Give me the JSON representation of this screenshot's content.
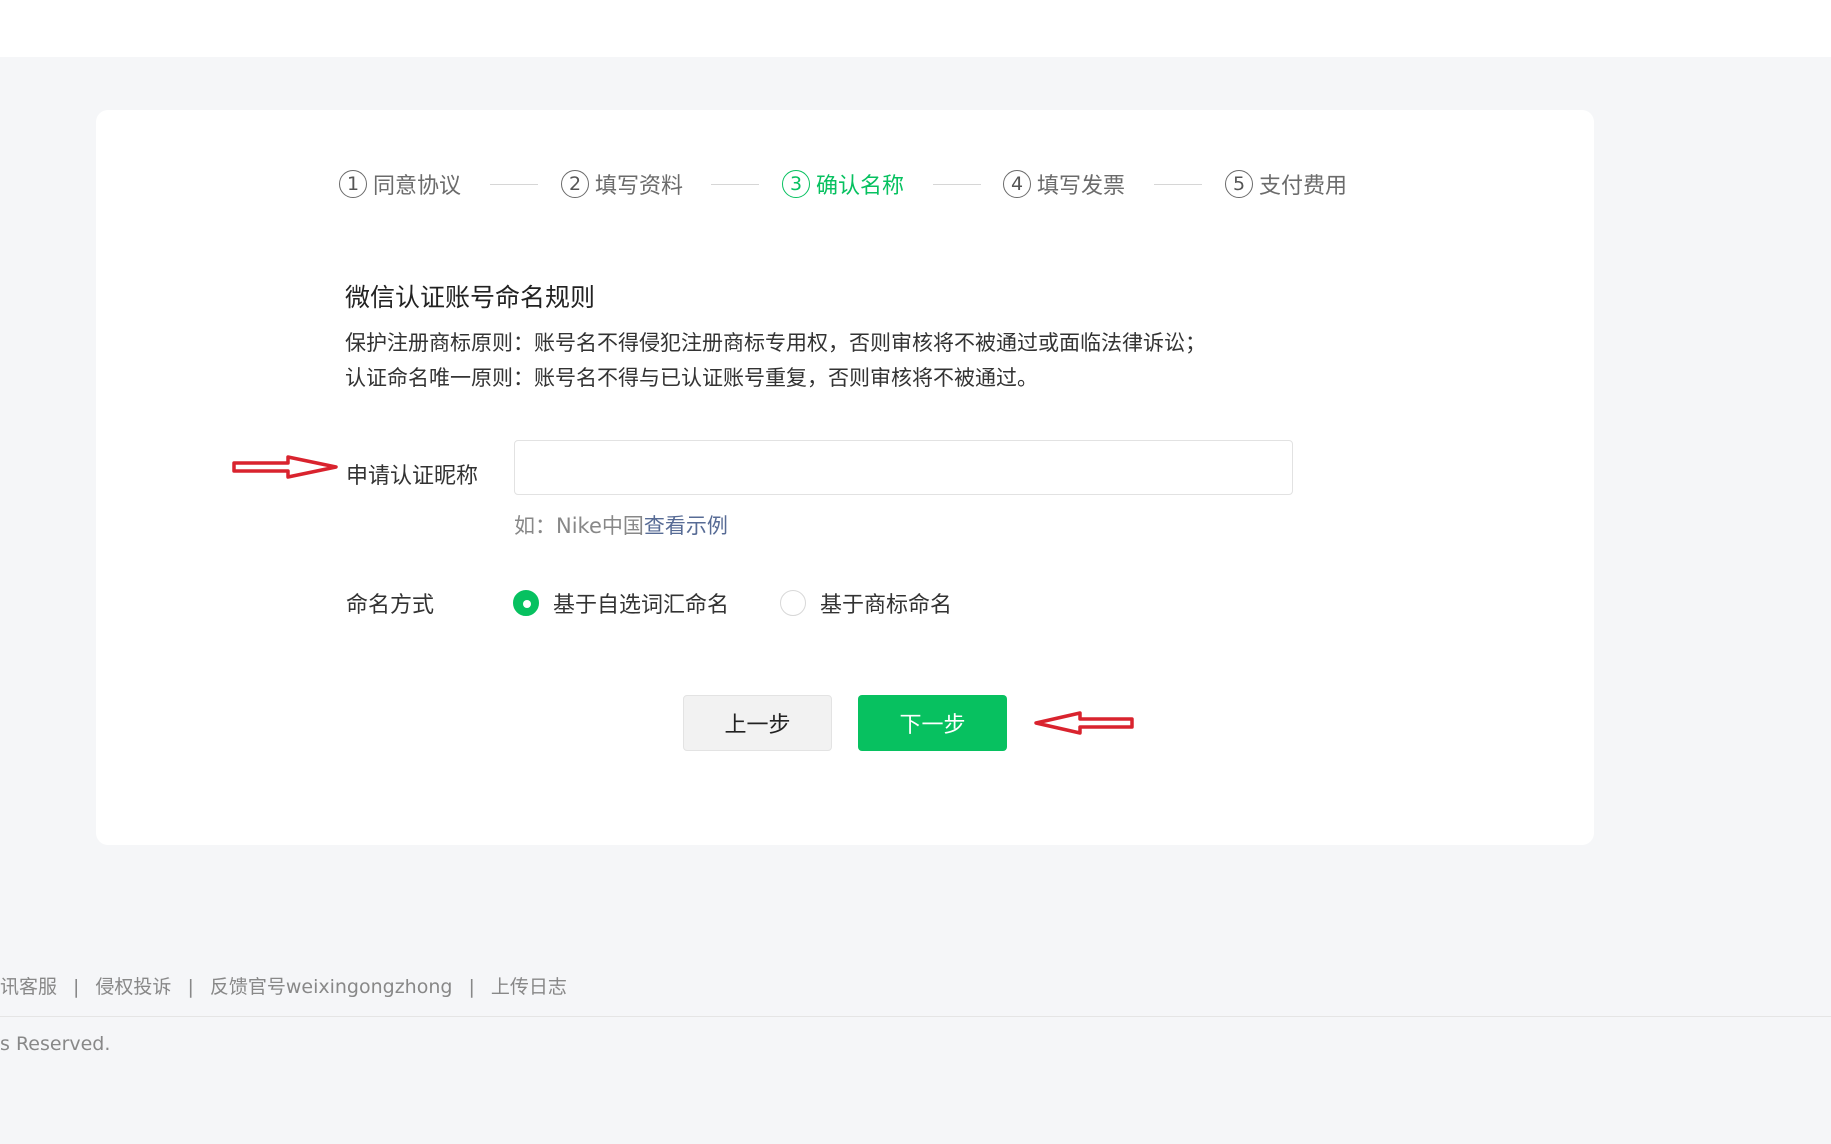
{
  "steps": [
    {
      "num": "1",
      "label": "同意协议"
    },
    {
      "num": "2",
      "label": "填写资料"
    },
    {
      "num": "3",
      "label": "确认名称",
      "active": true
    },
    {
      "num": "4",
      "label": "填写发票"
    },
    {
      "num": "5",
      "label": "支付费用"
    }
  ],
  "rules": {
    "title": "微信认证账号命名规则",
    "line1": "保护注册商标原则：账号名不得侵犯注册商标专用权，否则审核将不被通过或面临法律诉讼；",
    "line2": "认证命名唯一原则：账号名不得与已认证账号重复，否则审核将不被通过。"
  },
  "nickname": {
    "label": "申请认证昵称",
    "value": "",
    "hint_prefix": "如：Nike中国",
    "hint_link": "查看示例"
  },
  "naming": {
    "label": "命名方式",
    "options": [
      {
        "label": "基于自选词汇命名",
        "checked": true
      },
      {
        "label": "基于商标命名",
        "checked": false
      }
    ]
  },
  "buttons": {
    "prev": "上一步",
    "next": "下一步"
  },
  "footer": {
    "links": [
      "讯客服",
      "侵权投诉",
      "反馈官号weixingongzhong",
      "上传日志"
    ],
    "separator": "|",
    "copyright": "s Reserved."
  },
  "colors": {
    "accent": "#07c160",
    "annotation_arrow": "#d9232e"
  }
}
